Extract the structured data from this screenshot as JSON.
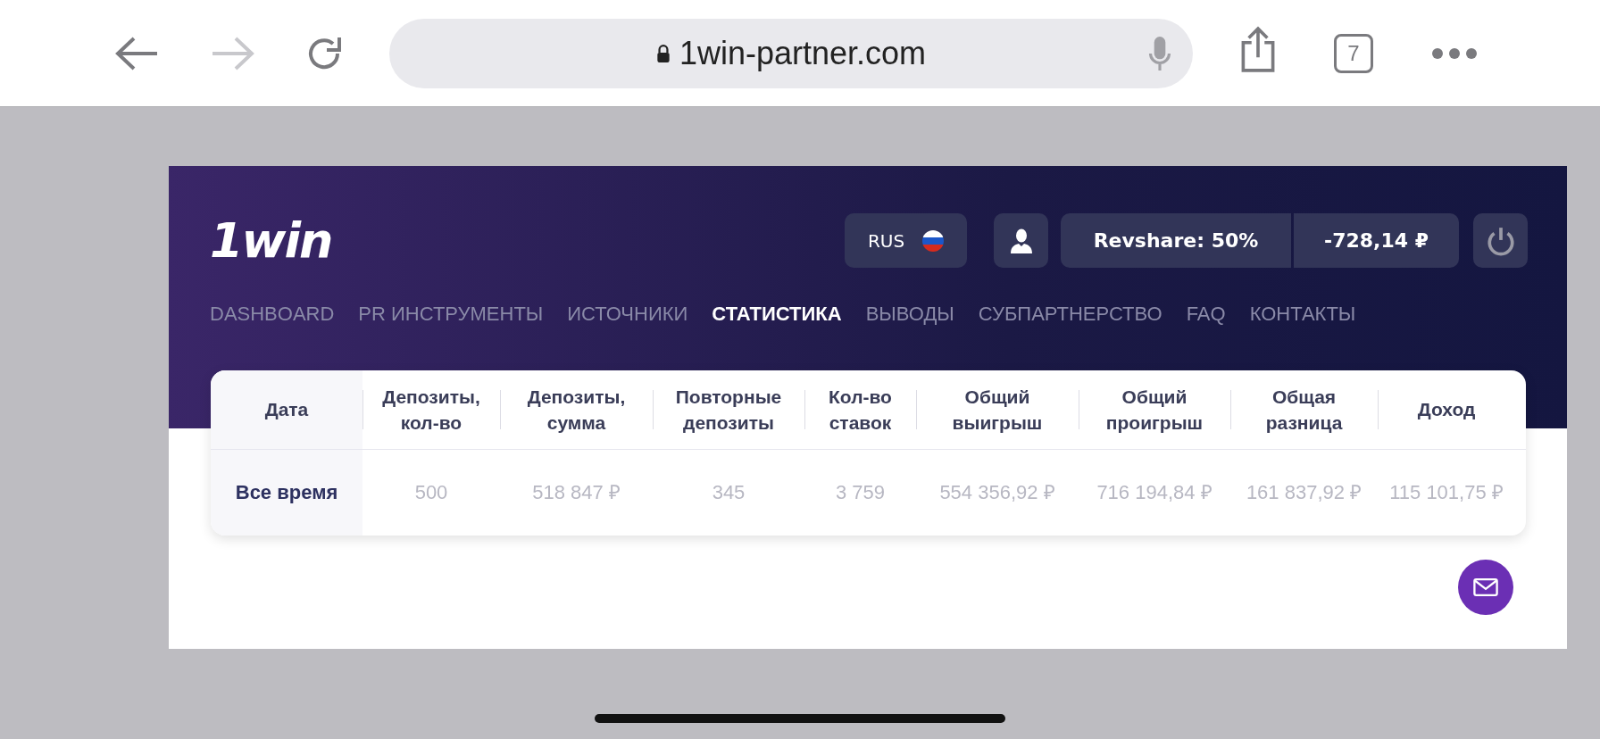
{
  "browser": {
    "url": "1win-partner.com",
    "tab_count": "7"
  },
  "header": {
    "logo": "1win",
    "language": "RUS",
    "revshare": "Revshare: 50%",
    "balance": "-728,14 ₽"
  },
  "nav": [
    {
      "label": "DASHBOARD",
      "selected": false
    },
    {
      "label": "PR ИНСТРУМЕНТЫ",
      "selected": false
    },
    {
      "label": "ИСТОЧНИКИ",
      "selected": false
    },
    {
      "label": "СТАТИСТИКА",
      "selected": true
    },
    {
      "label": "ВЫВОДЫ",
      "selected": false
    },
    {
      "label": "СУБПАРТНЕРСТВО",
      "selected": false
    },
    {
      "label": "FAQ",
      "selected": false
    },
    {
      "label": "КОНТАКТЫ",
      "selected": false
    }
  ],
  "table": {
    "columns": [
      "Дата",
      "Депозиты, кол-во",
      "Депозиты, сумма",
      "Повторные депозиты",
      "Кол-во ставок",
      "Общий выигрыш",
      "Общий проигрыш",
      "Общая разница",
      "Доход"
    ],
    "rows": [
      [
        "Все время",
        "500",
        "518 847 ₽",
        "345",
        "3 759",
        "554 356,92 ₽",
        "716 194,84 ₽",
        "161 837,92 ₽",
        "115 101,75 ₽"
      ]
    ]
  }
}
